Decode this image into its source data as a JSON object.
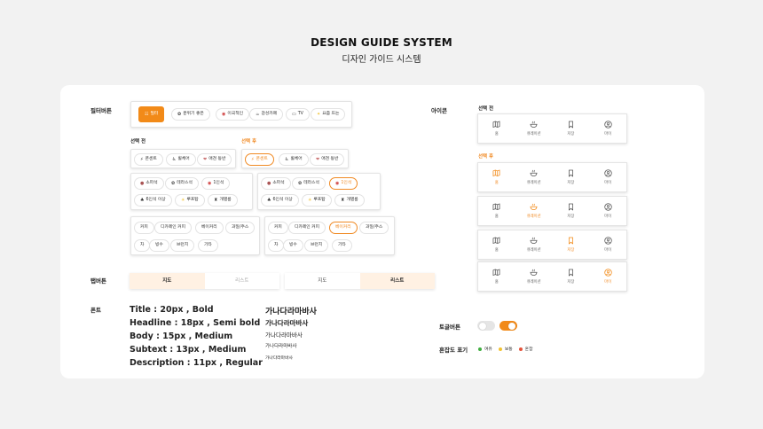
{
  "header": {
    "title": "DESIGN GUIDE SYSTEM",
    "subtitle": "디자인 가이드 시스템"
  },
  "sections": {
    "filter": "필터버튼",
    "icon": "아이콘",
    "tab": "탭버튼",
    "font": "폰트",
    "toggle": "토글버튼",
    "crowd": "혼잡도 표기"
  },
  "states": {
    "before": "선택 전",
    "after": "선택 후"
  },
  "filter_bar": [
    {
      "label": "필터",
      "icon": "☷"
    },
    {
      "label": "분위기 좋은",
      "icon": "✿"
    },
    {
      "label": "이국적인",
      "icon": "◉"
    },
    {
      "label": "감성카페",
      "icon": "☕"
    },
    {
      "label": "TV",
      "icon": "▭"
    },
    {
      "label": "요즘 뜨는",
      "icon": "✦"
    }
  ],
  "group1": [
    {
      "label": "콘센트",
      "icon": "⚡"
    },
    {
      "label": "휠체어",
      "icon": "♿"
    },
    {
      "label": "애견 동반",
      "icon": "❤"
    }
  ],
  "group2_row1": [
    {
      "label": "소파석",
      "icon": "●"
    },
    {
      "label": "테라스석",
      "icon": "✿"
    },
    {
      "label": "1인석",
      "icon": "◉"
    }
  ],
  "group2_row2": [
    {
      "label": "6인석 이상",
      "icon": "♣"
    },
    {
      "label": "루프탑",
      "icon": "☀"
    },
    {
      "label": "개별룸",
      "icon": "♜"
    }
  ],
  "menu_row1": [
    "커피",
    "디카페인 커피",
    "베이커리",
    "과일/주스"
  ],
  "menu_row2": [
    "차",
    "빙수",
    "브런치",
    "기타"
  ],
  "tabs": {
    "map": "지도",
    "list": "리스트"
  },
  "fonts": {
    "specs": [
      "Title : 20px , Bold",
      "Headline : 18px , Semi bold",
      "Body : 15px , Medium",
      "Subtext : 13px , Medium",
      "Description : 11px , Regular"
    ],
    "sample": "가나다라마바사"
  },
  "nav_items": [
    {
      "label": "홈",
      "icon": "map-icon"
    },
    {
      "label": "큐레이션",
      "icon": "bowl-icon"
    },
    {
      "label": "저장",
      "icon": "bookmark-icon"
    },
    {
      "label": "마이",
      "icon": "user-icon"
    }
  ],
  "crowd_levels": [
    {
      "label": "여유",
      "color": "#3fae3f"
    },
    {
      "label": "보통",
      "color": "#f2c230"
    },
    {
      "label": "혼잡",
      "color": "#e5533b"
    }
  ],
  "colors": {
    "accent": "#f28a18"
  }
}
